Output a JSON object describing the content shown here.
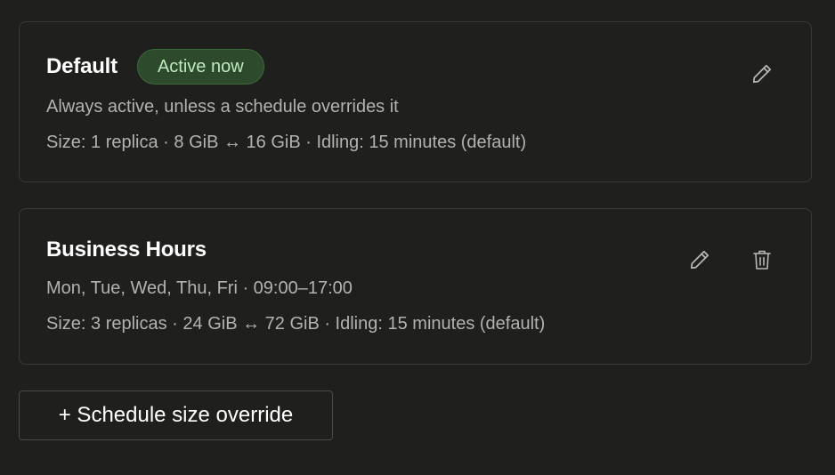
{
  "schedules": [
    {
      "title": "Default",
      "badge": "Active now",
      "description": "Always active, unless a schedule overrides it",
      "details": "Size: 1 replica · 8 GiB ↔ 16 GiB · Idling: 15 minutes (default)",
      "actions": [
        "pencil-icon"
      ]
    },
    {
      "title": "Business Hours",
      "description": "Mon, Tue, Wed, Thu, Fri · 09:00–17:00",
      "details": "Size: 3 replicas · 24 GiB ↔ 72 GiB · Idling: 15 minutes (default)",
      "actions": [
        "pencil-icon",
        "trash-icon"
      ]
    }
  ],
  "add_button": {
    "label": "+ Schedule size override"
  },
  "colors": {
    "background": "#1f1f1d",
    "card_border": "#3a3a37",
    "badge_bg": "#2d4a2c",
    "badge_text": "#bfeabb",
    "muted_text": "#b3b3ae"
  }
}
